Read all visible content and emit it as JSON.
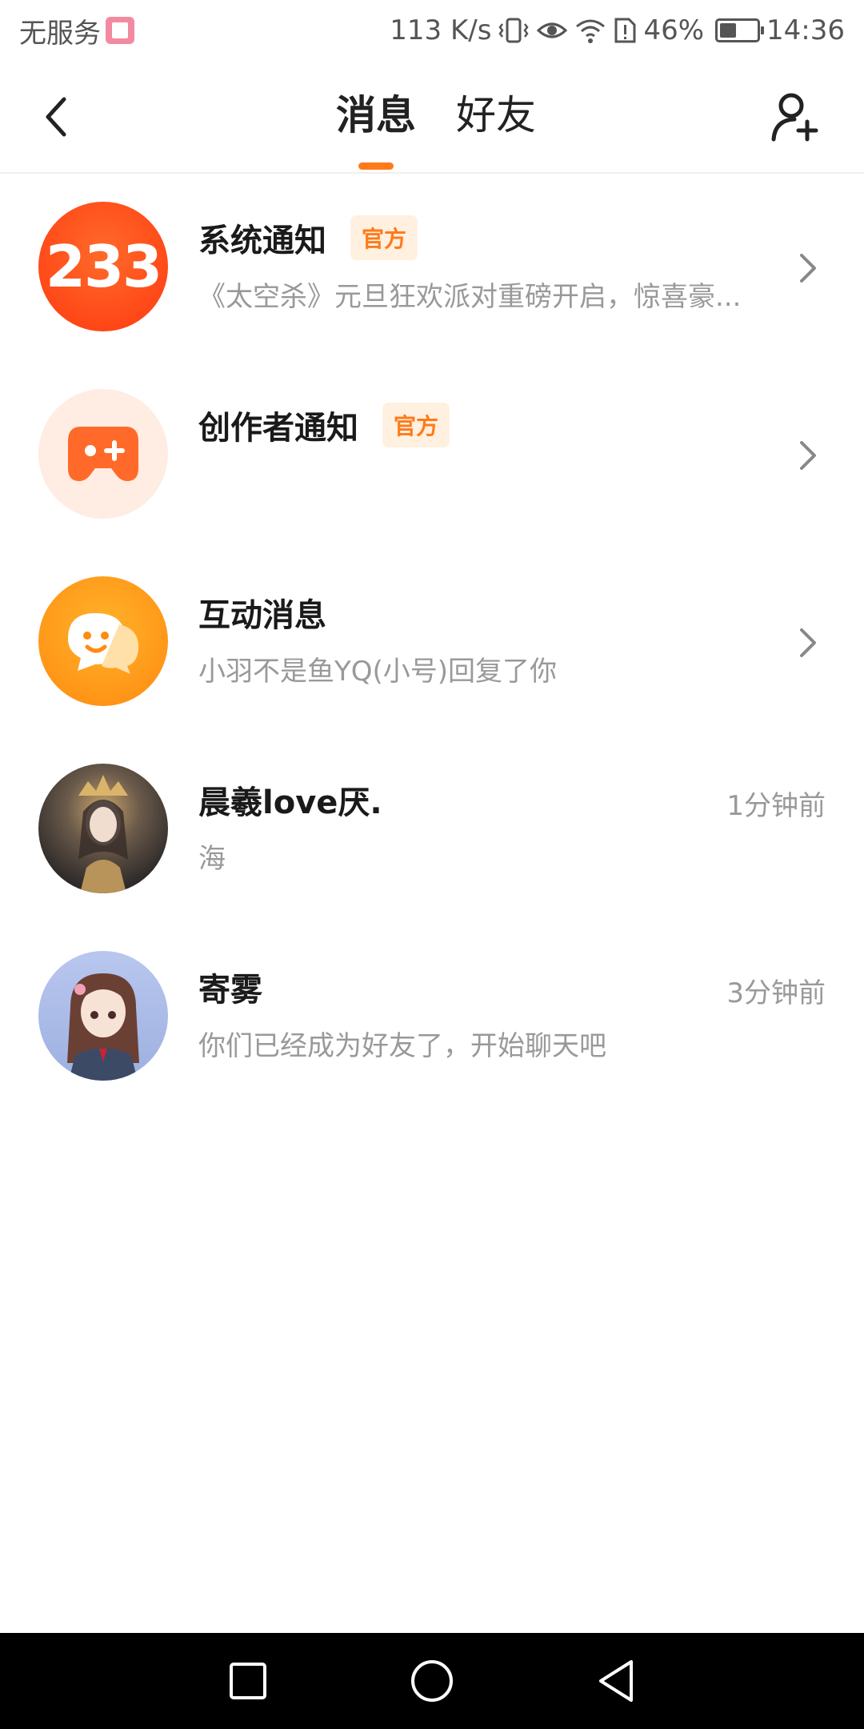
{
  "status_bar": {
    "carrier": "无服务",
    "net_speed": "113 K/s",
    "battery_pct": "46%",
    "battery_level": 0.46,
    "time": "14:36"
  },
  "header": {
    "tabs": [
      {
        "label": "消息",
        "active": true
      },
      {
        "label": "好友",
        "active": false
      }
    ]
  },
  "messages": [
    {
      "title": "系统通知",
      "badge": "官方",
      "subtitle": "《太空杀》元旦狂欢派对重磅开启，惊喜豪...",
      "avatar_text": "233",
      "has_chevron": true
    },
    {
      "title": "创作者通知",
      "badge": "官方",
      "subtitle": "",
      "has_chevron": true
    },
    {
      "title": "互动消息",
      "badge": "",
      "subtitle": "小羽不是鱼YQ(小号)回复了你",
      "has_chevron": true
    },
    {
      "title": "晨羲love厌.",
      "subtitle": "海",
      "time": "1分钟前"
    },
    {
      "title": "寄雾",
      "subtitle": "你们已经成为好友了，开始聊天吧",
      "time": "3分钟前"
    }
  ],
  "colors": {
    "accent": "#ff7a1a",
    "badge_bg": "#fff0e0",
    "subtitle": "#999999"
  }
}
